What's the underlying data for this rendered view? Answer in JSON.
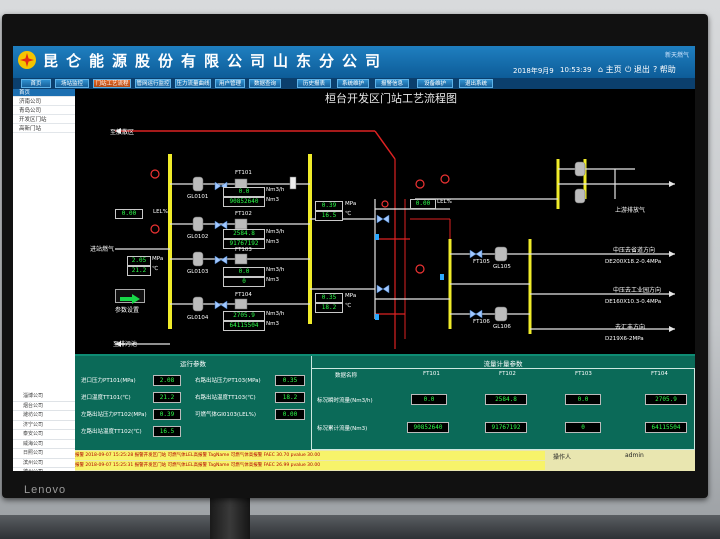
{
  "header": {
    "company": "昆仑能源股份有限公司山东分公司",
    "date": "2018年9月9",
    "time": "10:53:39",
    "home_label": "主页",
    "logout_label": "退出",
    "help_label": "帮助",
    "corp_text": "新天燃气"
  },
  "tabs": [
    {
      "label": "首页"
    },
    {
      "label": "场站监控"
    },
    {
      "label": "门站工艺流程"
    },
    {
      "label": "管网运行监控"
    },
    {
      "label": "压力流量曲线"
    },
    {
      "label": "用户管理"
    },
    {
      "label": "数据查询"
    },
    {
      "label": "历史报表"
    },
    {
      "label": "系统维护"
    },
    {
      "label": "报警信息"
    },
    {
      "label": "设备维护"
    },
    {
      "label": "退出系统"
    }
  ],
  "sidebar": {
    "items": [
      {
        "label": "首页"
      },
      {
        "label": "济南公司"
      },
      {
        "label": "青岛公司"
      },
      {
        "label": "开发区门站"
      },
      {
        "label": "高新门站"
      }
    ],
    "list": [
      "淄博公司",
      "烟台公司",
      "潍坊公司",
      "济宁公司",
      "泰安公司",
      "威海公司",
      "日照公司",
      "滨州公司",
      "德州公司",
      "聊城公司",
      "临沂公司",
      "菏泽公司",
      "枣庄公司",
      "东营公司",
      "莱芜公司"
    ]
  },
  "diagram": {
    "title": "桓台开发区门站工艺流程图",
    "to_discharge": "至放散区",
    "incoming_gas": "进站燃气",
    "sewage": "至排污池",
    "param_setting": "参数设置",
    "lel_left": {
      "label": "LEL%",
      "value": "0.00"
    },
    "lel_right": {
      "label": "LEL%",
      "value": "0.00"
    },
    "inlet_pressure": {
      "value": "2.05",
      "unit": "MPa"
    },
    "inlet_temp": {
      "value": "21.2",
      "unit": "℃"
    },
    "ft101": {
      "flow": "0.0",
      "total": "90852640",
      "flow_unit": "Nm3/h",
      "total_unit": "Nm3",
      "tag": "FT101"
    },
    "ft102": {
      "flow": "2584.8",
      "total": "91767192",
      "flow_unit": "Nm3/h",
      "total_unit": "Nm3",
      "tag": "FT102"
    },
    "ft103": {
      "flow": "0.0",
      "total": "0",
      "flow_unit": "Nm3/h",
      "total_unit": "Nm3",
      "tag": "FT103"
    },
    "ft104": {
      "flow": "2705.9",
      "total": "64115504",
      "flow_unit": "Nm3/h",
      "total_unit": "Nm3",
      "tag": "FT104"
    },
    "out1": {
      "pressure": "0.39",
      "temp": "16.5",
      "p_unit": "MPa",
      "t_unit": "℃"
    },
    "out2": {
      "pressure": "0.35",
      "temp": "18.2",
      "p_unit": "MPa",
      "t_unit": "℃"
    },
    "gl_labels": [
      "GL0101",
      "GL0102",
      "GL0103",
      "GL0104",
      "GL105",
      "GL106"
    ],
    "ft_right": [
      "FT105",
      "FT106"
    ],
    "branches": [
      {
        "name": "上游排放气"
      },
      {
        "name": "中压去省道方向",
        "spec": "DE200X18.2-0.4MPa"
      },
      {
        "name": "中压去工业园方向",
        "spec": "DE160X10.3-0.4MPa"
      },
      {
        "name": "去汇丰方向",
        "spec": "D219X6-2MPa"
      }
    ]
  },
  "panel": {
    "run_params_title": "运行参数",
    "flow_params_title": "流量计量参数",
    "run_params": [
      {
        "label": "进口压力PT101(MPa)",
        "value": "2.08"
      },
      {
        "label": "进口温度TT101(℃)",
        "value": "21.2"
      },
      {
        "label": "左路出站压力PT102(MPa)",
        "value": "0.39"
      },
      {
        "label": "左路出站温度TT102(℃)",
        "value": "16.5"
      },
      {
        "label": "右路出站压力PT103(MPa)",
        "value": "0.35"
      },
      {
        "label": "右路出站温度TT103(℃)",
        "value": "18.2"
      },
      {
        "label": "可燃气体GI0103(LEL%)",
        "value": "0.00"
      }
    ],
    "flow_table": {
      "headers": [
        "数据名称",
        "FT101",
        "FT102",
        "FT103",
        "FT104"
      ],
      "rows": [
        {
          "name": "标况瞬时流量(Nm3/h)",
          "values": [
            "0.0",
            "2584.8",
            "0.0",
            "2705.9"
          ]
        },
        {
          "name": "标况累计流量(Nm3)",
          "values": [
            "90852640",
            "91767192",
            "0",
            "64115504"
          ]
        }
      ]
    }
  },
  "alarm": {
    "rows": [
      "报警   2018-09-07 15:25:28   报警开发区门站 可燃气体LEL高报警   TagName 可燃气体高报警 FAEC 30.70 pvalue 30.00",
      "报警   2018-09-07 15:25:31   报警开发区门站 可燃气体LEL高报警   TagName 可燃气体高报警 FAEC 26.99 pvalue 30.00"
    ],
    "operator_label": "操作人",
    "user": "admin"
  },
  "brand": "Lenovo"
}
